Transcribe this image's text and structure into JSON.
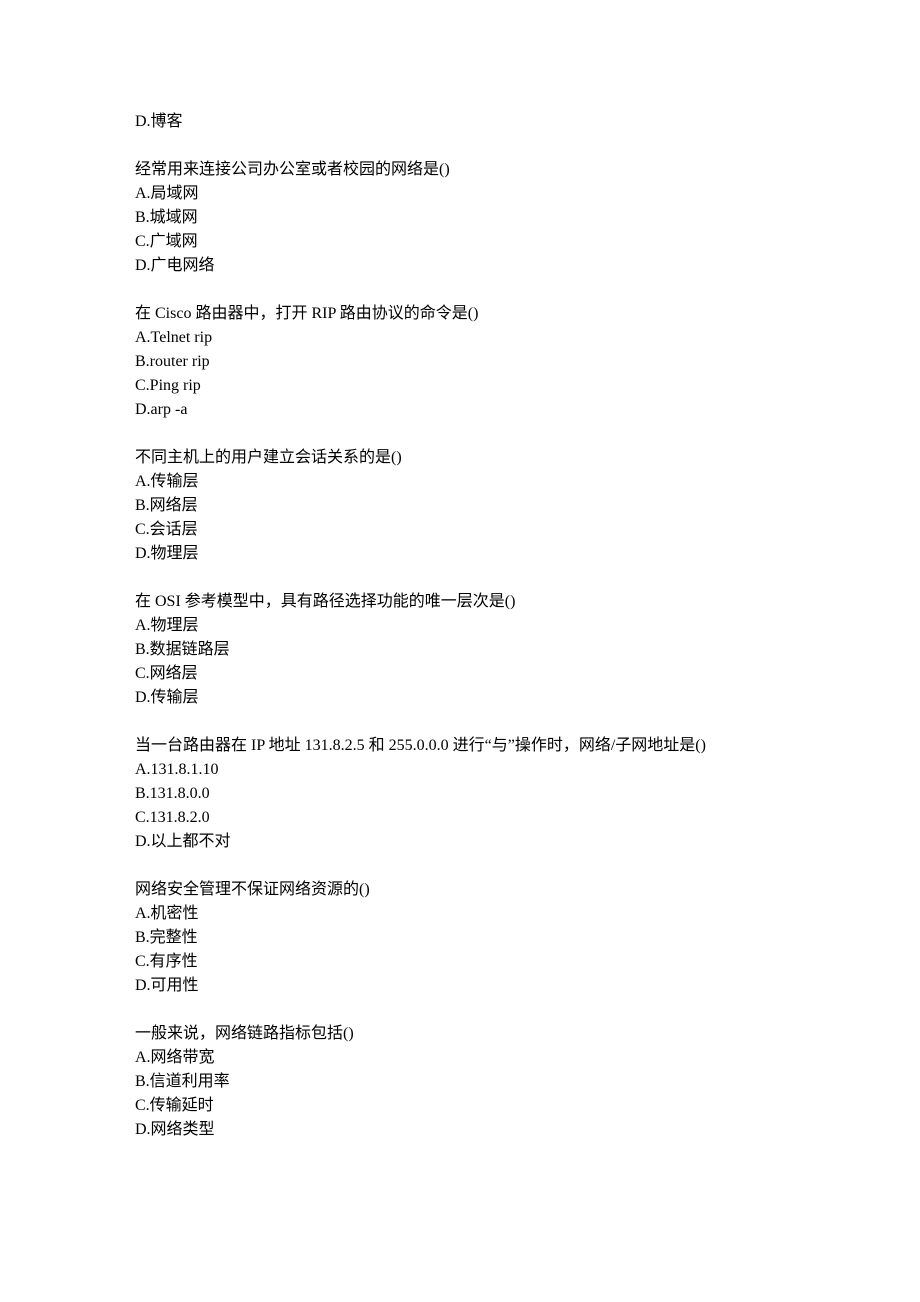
{
  "blocks": [
    {
      "lines": [
        "D.博客"
      ]
    },
    {
      "lines": [
        "经常用来连接公司办公室或者校园的网络是()",
        "A.局域网",
        "B.城域网",
        "C.广域网",
        "D.广电网络"
      ]
    },
    {
      "lines": [
        "在 Cisco 路由器中，打开 RIP 路由协议的命令是()",
        "A.Telnet rip",
        "B.router rip",
        "C.Ping rip",
        "D.arp -a"
      ]
    },
    {
      "lines": [
        "不同主机上的用户建立会话关系的是()",
        "A.传输层",
        "B.网络层",
        "C.会话层",
        "D.物理层"
      ]
    },
    {
      "lines": [
        "在 OSI 参考模型中，具有路径选择功能的唯一层次是()",
        "A.物理层",
        "B.数据链路层",
        "C.网络层",
        "D.传输层"
      ]
    },
    {
      "lines": [
        "当一台路由器在 IP 地址 131.8.2.5 和 255.0.0.0 进行“与”操作时，网络/子网地址是()",
        "A.131.8.1.10",
        "B.131.8.0.0",
        "C.131.8.2.0",
        "D.以上都不对"
      ]
    },
    {
      "lines": [
        "网络安全管理不保证网络资源的()",
        "A.机密性",
        "B.完整性",
        "C.有序性",
        "D.可用性"
      ]
    },
    {
      "lines": [
        "一般来说，网络链路指标包括()",
        "A.网络带宽",
        "B.信道利用率",
        "C.传输延时",
        "D.网络类型"
      ]
    }
  ]
}
